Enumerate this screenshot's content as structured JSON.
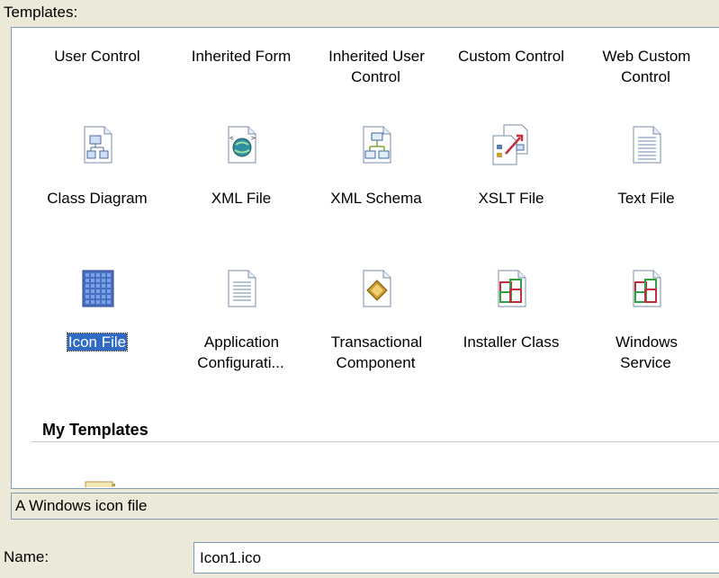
{
  "templates_label": "Templates:",
  "items": [
    {
      "label": "User Control",
      "icon": "user-control-icon"
    },
    {
      "label": "Inherited Form",
      "icon": "inherited-form-icon"
    },
    {
      "label": "Inherited User Control",
      "icon": "inherited-user-control-icon"
    },
    {
      "label": "Custom Control",
      "icon": "custom-control-icon"
    },
    {
      "label": "Web Custom Control",
      "icon": "web-custom-control-icon"
    },
    {
      "label": "Class Diagram",
      "icon": "class-diagram-icon"
    },
    {
      "label": "XML File",
      "icon": "xml-file-icon"
    },
    {
      "label": "XML Schema",
      "icon": "xml-schema-icon"
    },
    {
      "label": "XSLT File",
      "icon": "xslt-file-icon"
    },
    {
      "label": "Text File",
      "icon": "text-file-icon"
    },
    {
      "label": "Icon File",
      "icon": "icon-file-icon",
      "selected": true
    },
    {
      "label": "Application Configurati...",
      "icon": "app-config-icon"
    },
    {
      "label": "Transactional Component",
      "icon": "transactional-component-icon"
    },
    {
      "label": "Installer Class",
      "icon": "installer-class-icon"
    },
    {
      "label": "Windows Service",
      "icon": "windows-service-icon"
    }
  ],
  "my_templates_header": "My Templates",
  "description": "A Windows icon file",
  "name_label": "Name:",
  "name_value": "Icon1.ico",
  "colors": {
    "selection": "#316ac5",
    "window": "#ece9d8",
    "border": "#7f9db9"
  }
}
